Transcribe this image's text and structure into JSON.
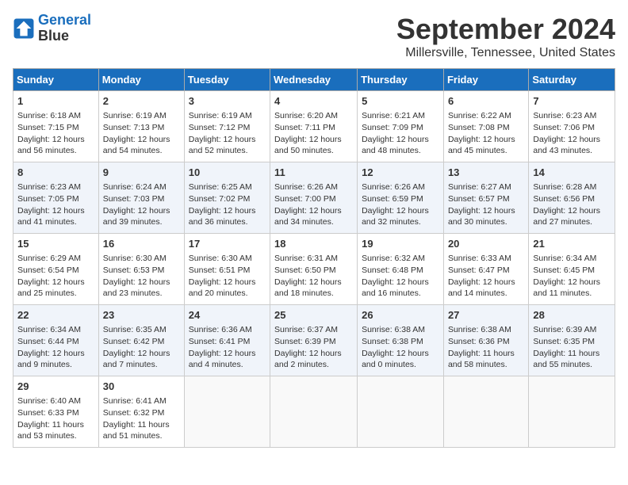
{
  "logo": {
    "line1": "General",
    "line2": "Blue"
  },
  "title": "September 2024",
  "location": "Millersville, Tennessee, United States",
  "days_of_week": [
    "Sunday",
    "Monday",
    "Tuesday",
    "Wednesday",
    "Thursday",
    "Friday",
    "Saturday"
  ],
  "weeks": [
    [
      {
        "day": "1",
        "sunrise": "Sunrise: 6:18 AM",
        "sunset": "Sunset: 7:15 PM",
        "daylight": "Daylight: 12 hours and 56 minutes."
      },
      {
        "day": "2",
        "sunrise": "Sunrise: 6:19 AM",
        "sunset": "Sunset: 7:13 PM",
        "daylight": "Daylight: 12 hours and 54 minutes."
      },
      {
        "day": "3",
        "sunrise": "Sunrise: 6:19 AM",
        "sunset": "Sunset: 7:12 PM",
        "daylight": "Daylight: 12 hours and 52 minutes."
      },
      {
        "day": "4",
        "sunrise": "Sunrise: 6:20 AM",
        "sunset": "Sunset: 7:11 PM",
        "daylight": "Daylight: 12 hours and 50 minutes."
      },
      {
        "day": "5",
        "sunrise": "Sunrise: 6:21 AM",
        "sunset": "Sunset: 7:09 PM",
        "daylight": "Daylight: 12 hours and 48 minutes."
      },
      {
        "day": "6",
        "sunrise": "Sunrise: 6:22 AM",
        "sunset": "Sunset: 7:08 PM",
        "daylight": "Daylight: 12 hours and 45 minutes."
      },
      {
        "day": "7",
        "sunrise": "Sunrise: 6:23 AM",
        "sunset": "Sunset: 7:06 PM",
        "daylight": "Daylight: 12 hours and 43 minutes."
      }
    ],
    [
      {
        "day": "8",
        "sunrise": "Sunrise: 6:23 AM",
        "sunset": "Sunset: 7:05 PM",
        "daylight": "Daylight: 12 hours and 41 minutes."
      },
      {
        "day": "9",
        "sunrise": "Sunrise: 6:24 AM",
        "sunset": "Sunset: 7:03 PM",
        "daylight": "Daylight: 12 hours and 39 minutes."
      },
      {
        "day": "10",
        "sunrise": "Sunrise: 6:25 AM",
        "sunset": "Sunset: 7:02 PM",
        "daylight": "Daylight: 12 hours and 36 minutes."
      },
      {
        "day": "11",
        "sunrise": "Sunrise: 6:26 AM",
        "sunset": "Sunset: 7:00 PM",
        "daylight": "Daylight: 12 hours and 34 minutes."
      },
      {
        "day": "12",
        "sunrise": "Sunrise: 6:26 AM",
        "sunset": "Sunset: 6:59 PM",
        "daylight": "Daylight: 12 hours and 32 minutes."
      },
      {
        "day": "13",
        "sunrise": "Sunrise: 6:27 AM",
        "sunset": "Sunset: 6:57 PM",
        "daylight": "Daylight: 12 hours and 30 minutes."
      },
      {
        "day": "14",
        "sunrise": "Sunrise: 6:28 AM",
        "sunset": "Sunset: 6:56 PM",
        "daylight": "Daylight: 12 hours and 27 minutes."
      }
    ],
    [
      {
        "day": "15",
        "sunrise": "Sunrise: 6:29 AM",
        "sunset": "Sunset: 6:54 PM",
        "daylight": "Daylight: 12 hours and 25 minutes."
      },
      {
        "day": "16",
        "sunrise": "Sunrise: 6:30 AM",
        "sunset": "Sunset: 6:53 PM",
        "daylight": "Daylight: 12 hours and 23 minutes."
      },
      {
        "day": "17",
        "sunrise": "Sunrise: 6:30 AM",
        "sunset": "Sunset: 6:51 PM",
        "daylight": "Daylight: 12 hours and 20 minutes."
      },
      {
        "day": "18",
        "sunrise": "Sunrise: 6:31 AM",
        "sunset": "Sunset: 6:50 PM",
        "daylight": "Daylight: 12 hours and 18 minutes."
      },
      {
        "day": "19",
        "sunrise": "Sunrise: 6:32 AM",
        "sunset": "Sunset: 6:48 PM",
        "daylight": "Daylight: 12 hours and 16 minutes."
      },
      {
        "day": "20",
        "sunrise": "Sunrise: 6:33 AM",
        "sunset": "Sunset: 6:47 PM",
        "daylight": "Daylight: 12 hours and 14 minutes."
      },
      {
        "day": "21",
        "sunrise": "Sunrise: 6:34 AM",
        "sunset": "Sunset: 6:45 PM",
        "daylight": "Daylight: 12 hours and 11 minutes."
      }
    ],
    [
      {
        "day": "22",
        "sunrise": "Sunrise: 6:34 AM",
        "sunset": "Sunset: 6:44 PM",
        "daylight": "Daylight: 12 hours and 9 minutes."
      },
      {
        "day": "23",
        "sunrise": "Sunrise: 6:35 AM",
        "sunset": "Sunset: 6:42 PM",
        "daylight": "Daylight: 12 hours and 7 minutes."
      },
      {
        "day": "24",
        "sunrise": "Sunrise: 6:36 AM",
        "sunset": "Sunset: 6:41 PM",
        "daylight": "Daylight: 12 hours and 4 minutes."
      },
      {
        "day": "25",
        "sunrise": "Sunrise: 6:37 AM",
        "sunset": "Sunset: 6:39 PM",
        "daylight": "Daylight: 12 hours and 2 minutes."
      },
      {
        "day": "26",
        "sunrise": "Sunrise: 6:38 AM",
        "sunset": "Sunset: 6:38 PM",
        "daylight": "Daylight: 12 hours and 0 minutes."
      },
      {
        "day": "27",
        "sunrise": "Sunrise: 6:38 AM",
        "sunset": "Sunset: 6:36 PM",
        "daylight": "Daylight: 11 hours and 58 minutes."
      },
      {
        "day": "28",
        "sunrise": "Sunrise: 6:39 AM",
        "sunset": "Sunset: 6:35 PM",
        "daylight": "Daylight: 11 hours and 55 minutes."
      }
    ],
    [
      {
        "day": "29",
        "sunrise": "Sunrise: 6:40 AM",
        "sunset": "Sunset: 6:33 PM",
        "daylight": "Daylight: 11 hours and 53 minutes."
      },
      {
        "day": "30",
        "sunrise": "Sunrise: 6:41 AM",
        "sunset": "Sunset: 6:32 PM",
        "daylight": "Daylight: 11 hours and 51 minutes."
      },
      null,
      null,
      null,
      null,
      null
    ]
  ]
}
